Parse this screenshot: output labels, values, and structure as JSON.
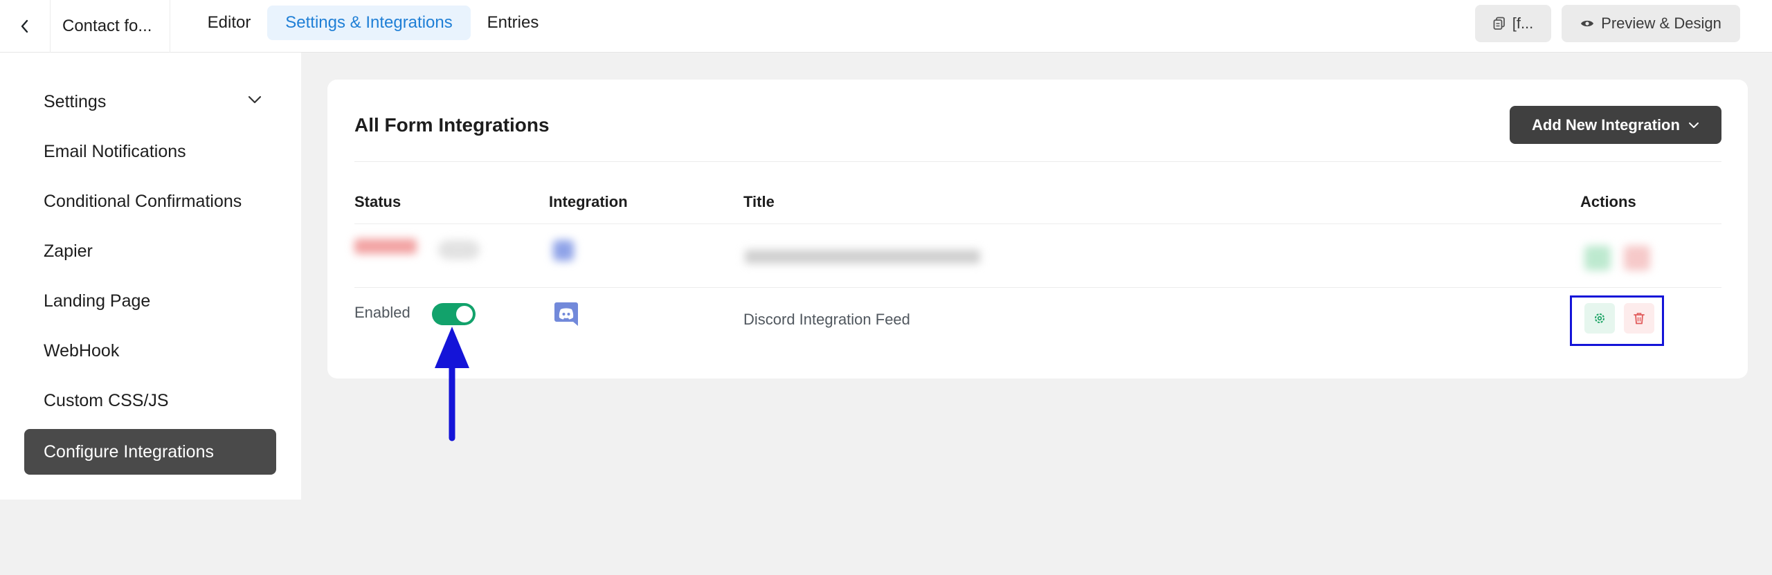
{
  "header": {
    "back_icon": "chevron-left-icon",
    "form_name": "Contact fo...",
    "tabs": [
      {
        "label": "Editor",
        "active": false
      },
      {
        "label": "Settings & Integrations",
        "active": true
      },
      {
        "label": "Entries",
        "active": false
      }
    ],
    "shortcode_button": {
      "icon": "copy-icon",
      "label": "[f..."
    },
    "preview_button": {
      "icon": "eye-icon",
      "label": "Preview & Design"
    }
  },
  "sidebar": {
    "items": [
      {
        "label": "Settings",
        "has_chevron": true
      },
      {
        "label": "Email Notifications"
      },
      {
        "label": "Conditional Confirmations"
      },
      {
        "label": "Zapier"
      },
      {
        "label": "Landing Page"
      },
      {
        "label": "WebHook"
      },
      {
        "label": "Custom CSS/JS"
      },
      {
        "label": "Configure Integrations",
        "active": true
      }
    ]
  },
  "main": {
    "title": "All Form Integrations",
    "add_button": {
      "label": "Add New Integration",
      "icon": "chevron-down-icon"
    },
    "columns": [
      "Status",
      "Integration",
      "Title",
      "Actions"
    ],
    "rows": [
      {
        "obscured": true
      },
      {
        "status": "Enabled",
        "enabled": true,
        "integration_icon": "discord-icon",
        "title": "Discord Integration Feed",
        "actions": [
          "gear-icon",
          "trash-icon"
        ]
      }
    ]
  },
  "colors": {
    "accent_blue": "#1f7fd6",
    "active_tab_bg": "#e9f3fd",
    "toggle_green": "#12a26b",
    "dark_button": "#404040",
    "annotation_blue": "#1414d8",
    "discord": "#7289da"
  }
}
